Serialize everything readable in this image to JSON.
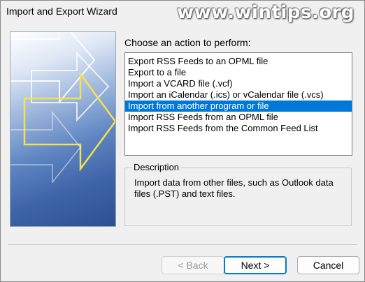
{
  "window": {
    "title": "Import and Export Wizard",
    "watermark": "www.wintips.org"
  },
  "prompt": "Choose an action to perform:",
  "actions": [
    {
      "label": "Export RSS Feeds to an OPML file",
      "selected": false
    },
    {
      "label": "Export to a file",
      "selected": false
    },
    {
      "label": "Import a VCARD file (.vcf)",
      "selected": false
    },
    {
      "label": "Import an iCalendar (.ics) or vCalendar file (.vcs)",
      "selected": false
    },
    {
      "label": "Import from another program or file",
      "selected": true
    },
    {
      "label": "Import RSS Feeds from an OPML file",
      "selected": false
    },
    {
      "label": "Import RSS Feeds from the Common Feed List",
      "selected": false
    }
  ],
  "description": {
    "legend": "Description",
    "text": "Import data from other files, such as Outlook data files (.PST) and text files."
  },
  "buttons": {
    "back": "< Back",
    "next": "Next >",
    "cancel": "Cancel"
  },
  "colors": {
    "selection": "#0078d7",
    "dialog_bg": "#f0f0f0",
    "side_art_dark": "#2d4f93"
  }
}
